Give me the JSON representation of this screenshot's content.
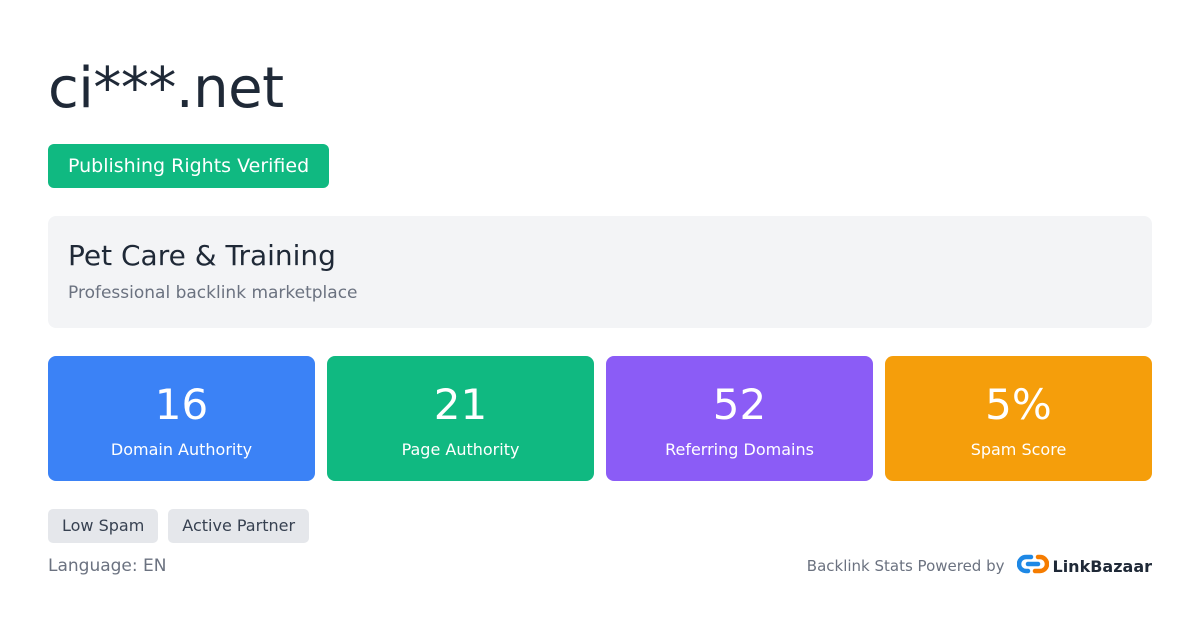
{
  "site": {
    "domain": "ci***.net",
    "verified_label": "Publishing Rights Verified",
    "category": "Pet Care & Training",
    "tagline": "Professional backlink marketplace"
  },
  "stats": [
    {
      "value": "16",
      "label": "Domain Authority",
      "color": "#3b82f6"
    },
    {
      "value": "21",
      "label": "Page Authority",
      "color": "#10b981"
    },
    {
      "value": "52",
      "label": "Referring Domains",
      "color": "#8b5cf6"
    },
    {
      "value": "5%",
      "label": "Spam Score",
      "color": "#f59e0b"
    }
  ],
  "tags": [
    "Low Spam",
    "Active Partner"
  ],
  "footer": {
    "language": "Language: EN",
    "powered_by": "Backlink Stats Powered by",
    "brand": "LinkBazaar",
    "brand_icon": "chain-link-icon",
    "brand_colors": {
      "blue": "#1e88e5",
      "orange": "#f57c00"
    }
  },
  "colors": {
    "verified": "#10b981",
    "card_bg": "#f3f4f6",
    "tag_bg": "#e5e7eb"
  }
}
